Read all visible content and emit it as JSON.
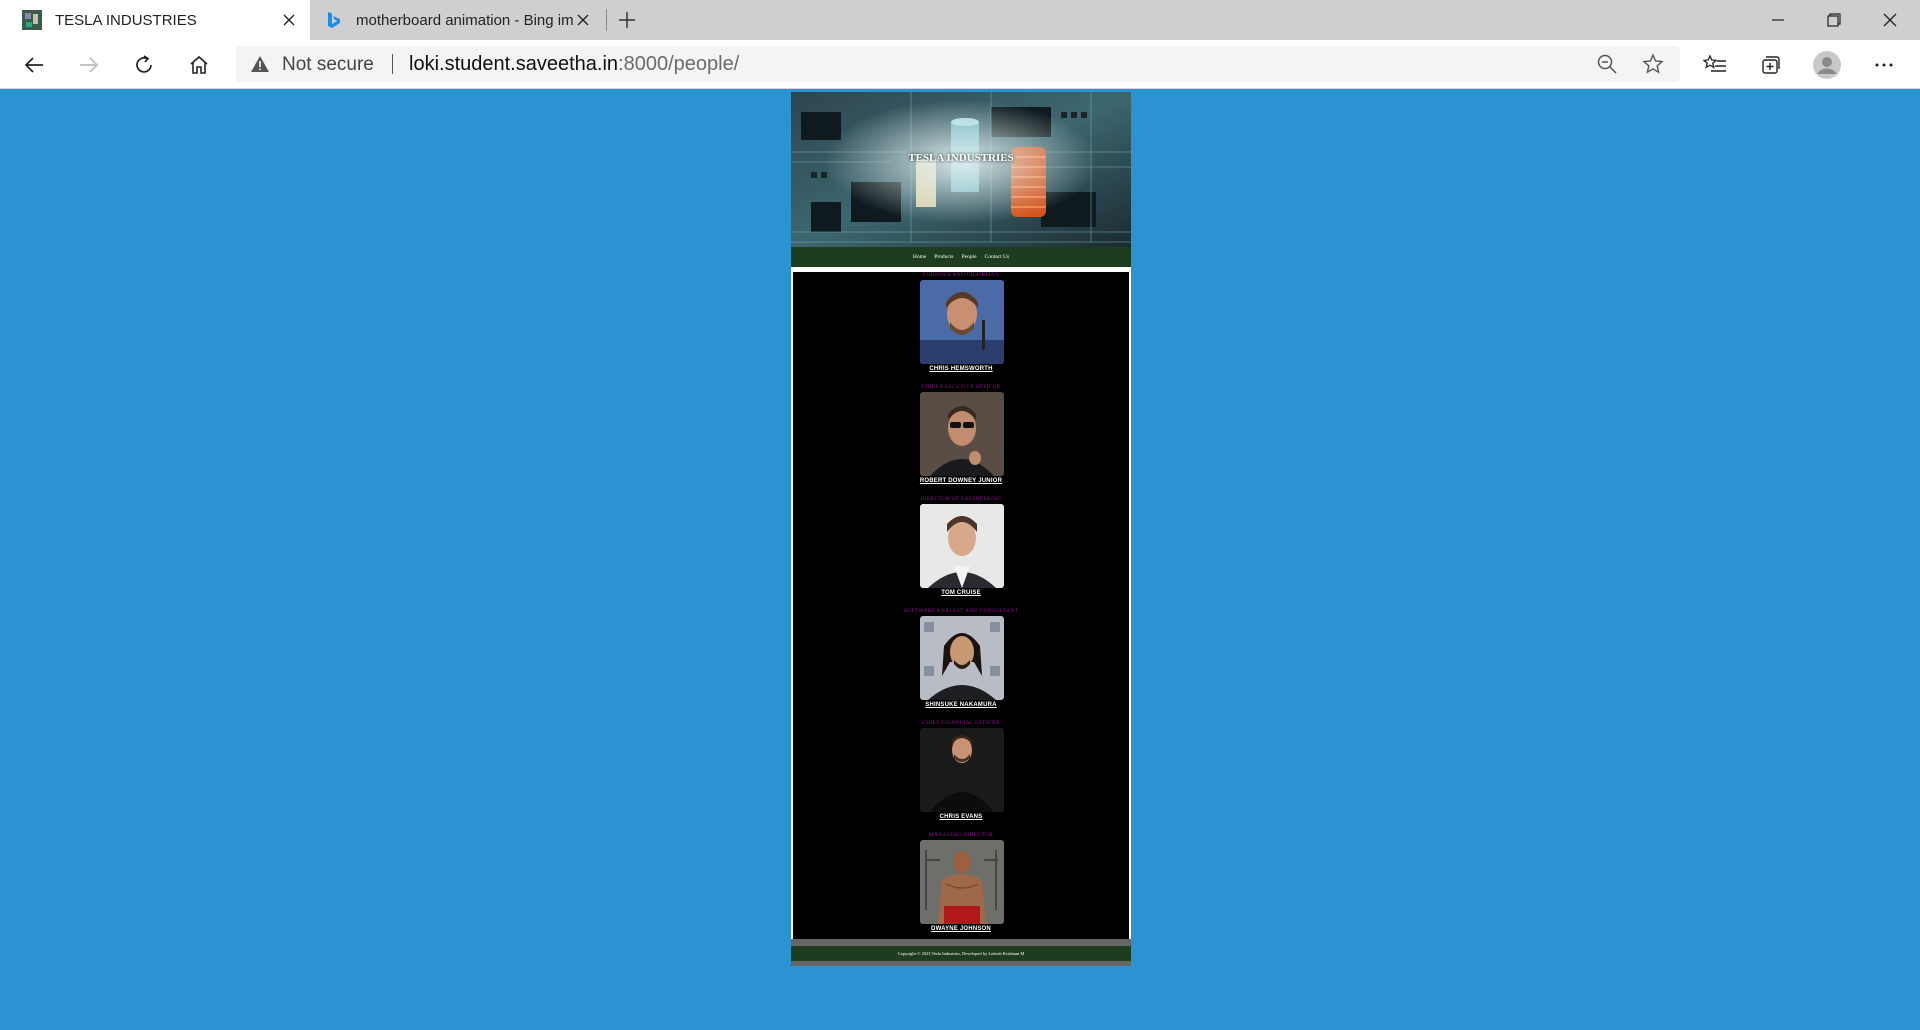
{
  "browser": {
    "tabs": [
      {
        "title": "TESLA INDUSTRIES",
        "active": true
      },
      {
        "title": "motherboard animation - Bing images",
        "active": false
      }
    ],
    "address": {
      "security_label": "Not secure",
      "url_host": "loki.student.saveetha.in",
      "url_rest": ":8000/people/"
    }
  },
  "site": {
    "title": "TESLA INDUSTRIES",
    "nav": [
      "Home",
      "Products",
      "People",
      "Contact Us"
    ],
    "people": [
      {
        "role": "FOUNDER AND CHAIRMAN",
        "name": "CHRIS HEMSWORTH"
      },
      {
        "role": "CHIEF EXECUTIVE OFFICER",
        "name": "ROBERT DOWNEY JUNIOR"
      },
      {
        "role": "DIRECTOR OF ENGINEERING",
        "name": "TOM CRUISE"
      },
      {
        "role": "SOFTWARE ANALYST AND CONSULTANT",
        "name": "SHINSUKE NAKAMURA"
      },
      {
        "role": "CHIEF FINANCIAL OFFICER",
        "name": "CHRIS EVANS"
      },
      {
        "role": "MANAGING DIRECTOR",
        "name": "DWAYNE JOHNSON"
      }
    ],
    "footer": "Copyright © 2023 Tesla Industries, Developed by Lokesh Krishnan M"
  },
  "colors": {
    "page_background": "#2b93d1",
    "nav_background": "#1e3d1e",
    "role_text": "#8b1a8b"
  }
}
